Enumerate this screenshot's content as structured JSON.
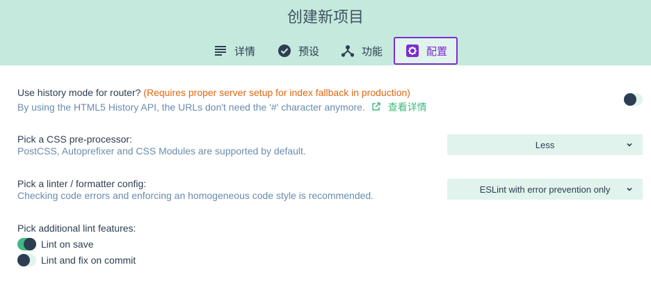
{
  "header": {
    "title": "创建新项目",
    "tabs": [
      {
        "label": "详情",
        "icon": "list-icon",
        "active": false
      },
      {
        "label": "预设",
        "icon": "check-circle-icon",
        "active": false
      },
      {
        "label": "功能",
        "icon": "fork-icon",
        "active": false
      },
      {
        "label": "配置",
        "icon": "settings-gear-icon",
        "active": true
      }
    ]
  },
  "history": {
    "title": "Use history mode for router?",
    "warning": "(Requires proper server setup for index fallback in production)",
    "desc": "By using the HTML5 History API, the URLs don't need the '#' character anymore.",
    "link": "查看详情",
    "enabled": false
  },
  "css": {
    "title": "Pick a CSS pre-processor:",
    "desc": "PostCSS, Autoprefixer and CSS Modules are supported by default.",
    "selected": "Less"
  },
  "linter": {
    "title": "Pick a linter / formatter config:",
    "desc": "Checking code errors and enforcing an homogeneous code style is recommended.",
    "selected": "ESLint with error prevention only"
  },
  "lint_features": {
    "title": "Pick additional lint features:",
    "items": [
      {
        "label": "Lint on save",
        "enabled": true
      },
      {
        "label": "Lint and fix on commit",
        "enabled": false
      }
    ]
  },
  "colors": {
    "header_bg": "#c5e9dd",
    "accent": "#42b983",
    "active_tab": "#7b2dd1",
    "warning": "#e0660f",
    "desc": "#6a8bad"
  }
}
